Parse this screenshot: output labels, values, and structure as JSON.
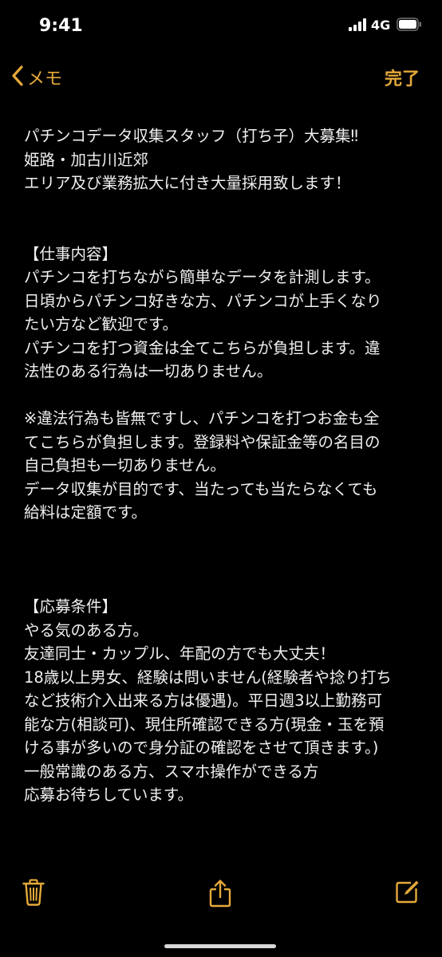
{
  "status": {
    "time": "9:41",
    "network": "4G"
  },
  "nav": {
    "back_label": "メモ",
    "done_label": "完了"
  },
  "note": {
    "lines": [
      "パチンコデータ収集スタッフ（打ち子）大募集‼",
      "姫路・加古川近郊",
      "エリア及び業務拡大に付き大量採用致します！",
      "",
      "",
      " 【仕事内容】",
      "パチンコを打ちながら簡単なデータを計測します。",
      "日頃からパチンコ好きな方、パチンコが上手くなり",
      "たい方など歓迎です。",
      "パチンコを打つ資金は全てこちらが負担します。違",
      "法性のある行為は一切ありません。",
      "",
      "※違法行為も皆無ですし、パチンコを打つお金も全",
      "てこちらが負担します。登録料や保証金等の名目の",
      "自己負担も一切ありません。",
      "データ収集が目的です、当たっても当たらなくても",
      "給料は定額です。",
      "",
      "",
      "",
      " 【応募条件】",
      "やる気のある方。",
      "友達同士・カップル、年配の方でも大丈夫！",
      "18歳以上男女、経験は問いません(経験者や捻り打ち",
      "など技術介入出来る方は優遇)。平日週3以上勤務可",
      "能な方(相談可)、現住所確認できる方(現金・玉を預",
      "ける事が多いので身分証の確認をさせて頂きます。)",
      "一般常識のある方、スマホ操作ができる方",
      "応募お待ちしています。"
    ]
  },
  "toolbar": {
    "icons": [
      "trash-icon",
      "share-icon",
      "compose-icon"
    ]
  },
  "colors": {
    "accent": "#e5a93a",
    "background": "#000000",
    "text": "#f0f0f0"
  }
}
